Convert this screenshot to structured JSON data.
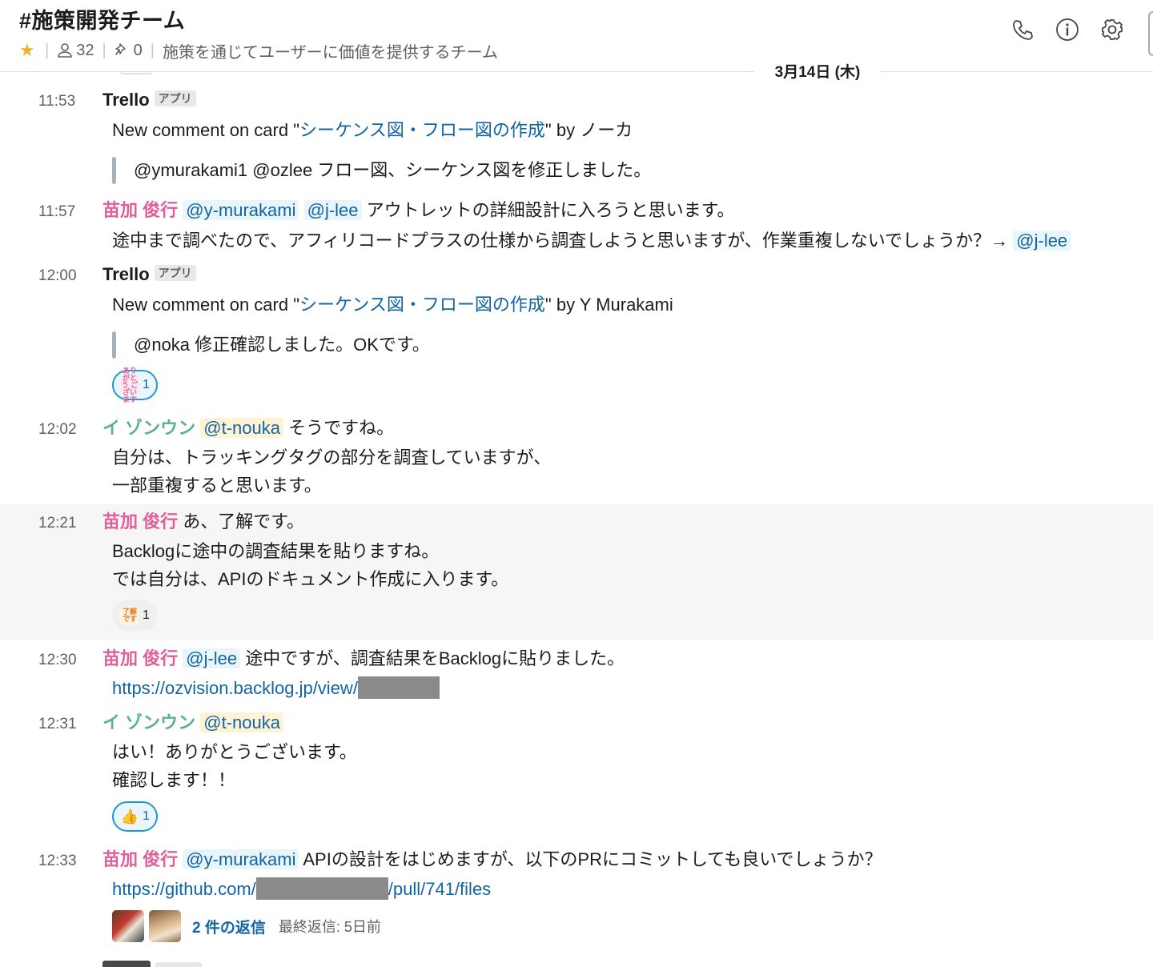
{
  "header": {
    "title": "#施策開発チーム",
    "members": "32",
    "pins": "0",
    "topic": "施策を通じてユーザーに価値を提供するチーム"
  },
  "date_divider": "3月14日 (木)",
  "messages": [
    {
      "time": "11:53",
      "author": "Trello",
      "badge": "アプリ",
      "line1_pre": "New comment on card \"",
      "line1_link": "シーケンス図・フロー図の作成",
      "line1_post": "\" by ノーカ",
      "quote": "@ymurakami1 @ozlee フロー図、シーケンス図を修正しました。"
    },
    {
      "time": "11:57",
      "author": "苗加 俊行",
      "mention1": "@y-murakami",
      "mention2": "@j-lee",
      "text1": " アウトレットの詳細設計に入ろうと思います。",
      "line2": "途中まで調べたので、アフィリコードプラスの仕様から調査しようと思いますが、作業重複しないでしょうか？→ ",
      "line2_mention": "@j-lee"
    },
    {
      "time": "12:00",
      "author": "Trello",
      "badge": "アプリ",
      "line1_pre": "New comment on card \"",
      "line1_link": "シーケンス図・フロー図の作成",
      "line1_post": "\" by Y Murakami",
      "quote": "@noka 修正確認しました。OKです。",
      "reaction_emoji": "ありがとう ございます",
      "reaction_count": "1"
    },
    {
      "time": "12:02",
      "author": "イ ゾンウン",
      "mention1": "@t-nouka",
      "text1": " そうですね。",
      "line2": "自分は、トラッキングタグの部分を調査していますが、",
      "line3": "一部重複すると思います。"
    },
    {
      "time": "12:21",
      "author": "苗加 俊行",
      "text1": " あ、了解です。",
      "line2": "Backlogに途中の調査結果を貼りますね。",
      "line3": "では自分は、APIのドキュメント作成に入ります。",
      "reaction_emoji": "了解 です",
      "reaction_count": "1"
    },
    {
      "time": "12:30",
      "author": "苗加 俊行",
      "mention1": "@j-lee",
      "text1": " 途中ですが、調査結果をBacklogに貼りました。",
      "link": "https://ozvision.backlog.jp/view/"
    },
    {
      "time": "12:31",
      "author": "イ ゾンウン",
      "mention1": "@t-nouka",
      "line2": "はい！ありがとうございます。",
      "line3": "確認します！！",
      "reaction_emoji": "👍",
      "reaction_count": "1"
    },
    {
      "time": "12:33",
      "author": "苗加 俊行",
      "mention1": "@y-murakami",
      "text1": " APIの設計をはじめますが、以下のPRにコミットしても良いでしょうか？",
      "link_pre": "https://github.com/",
      "link_post": "/pull/741/files",
      "thread_replies": "2 件の返信",
      "thread_last": "最終返信: 5日前"
    }
  ],
  "colors": {
    "accent_link": "#1264a3",
    "author_pink": "#e0609a",
    "author_green": "#5cb38a",
    "star": "#ecb22e"
  }
}
